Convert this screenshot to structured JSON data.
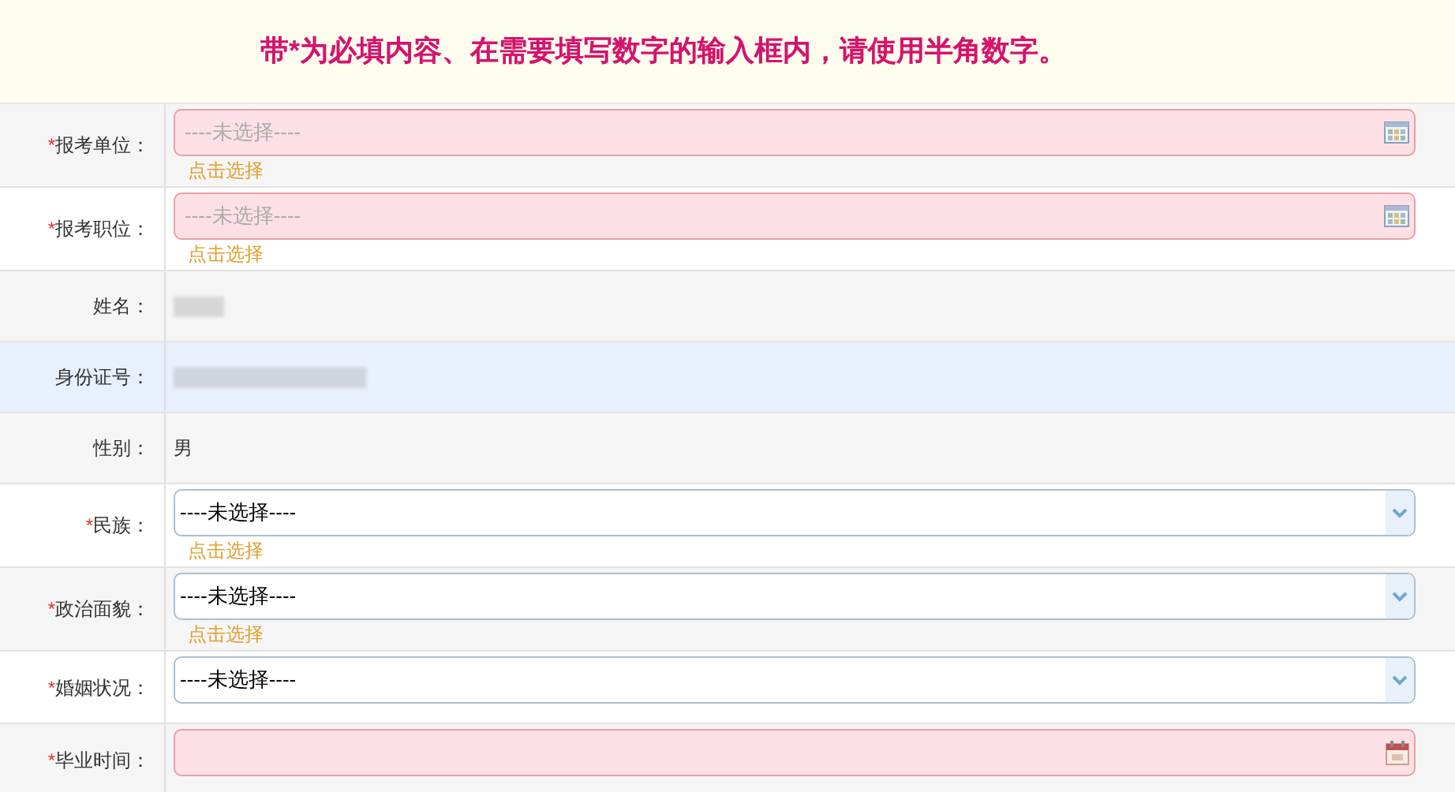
{
  "notice": "带*为必填内容、在需要填写数字的输入框内，请使用半角数字。",
  "rows": [
    {
      "kind": "picker",
      "required_mark": "*",
      "label": "报考单位：",
      "placeholder": "----未选择----",
      "hint": "点击选择",
      "highlighted": false
    },
    {
      "kind": "picker",
      "required_mark": "*",
      "label": "报考职位：",
      "placeholder": "----未选择----",
      "hint": "点击选择",
      "highlighted": false
    },
    {
      "kind": "blurred",
      "label": "姓名：",
      "highlighted": false
    },
    {
      "kind": "blurred",
      "label": "身份证号：",
      "highlighted": true
    },
    {
      "kind": "text",
      "label": "性别：",
      "value": "男",
      "highlighted": false
    },
    {
      "kind": "select",
      "required_mark": "*",
      "label": "民族：",
      "value": "----未选择----",
      "hint": "点击选择",
      "highlighted": false
    },
    {
      "kind": "select",
      "required_mark": "*",
      "label": "政治面貌：",
      "value": "----未选择----",
      "hint": "点击选择",
      "highlighted": false
    },
    {
      "kind": "select",
      "required_mark": "*",
      "label": "婚姻状况：",
      "value": "----未选择----",
      "highlighted": false
    },
    {
      "kind": "date",
      "required_mark": "*",
      "label": "毕业时间：",
      "highlighted": false
    }
  ]
}
